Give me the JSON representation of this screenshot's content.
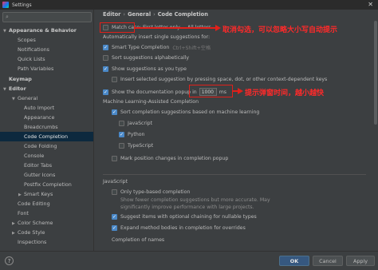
{
  "window": {
    "title": "Settings",
    "close": "✕"
  },
  "sidebar": {
    "search_icon": "search-icon",
    "items": [
      {
        "label": "Appearance & Behavior",
        "bold": true,
        "arrow": "▼"
      },
      {
        "label": "Scopes"
      },
      {
        "label": "Notifications"
      },
      {
        "label": "Quick Lists"
      },
      {
        "label": "Path Variables"
      },
      {
        "label": "Keymap",
        "bold": true
      },
      {
        "label": "Editor",
        "bold": true,
        "arrow": "▼"
      },
      {
        "label": "General",
        "arrow": "▼"
      },
      {
        "label": "Auto Import"
      },
      {
        "label": "Appearance"
      },
      {
        "label": "Breadcrumbs"
      },
      {
        "label": "Code Completion",
        "selected": true
      },
      {
        "label": "Code Folding"
      },
      {
        "label": "Console"
      },
      {
        "label": "Editor Tabs"
      },
      {
        "label": "Gutter Icons"
      },
      {
        "label": "Postfix Completion"
      },
      {
        "label": "Smart Keys",
        "arrow": "▶"
      },
      {
        "label": "Code Editing"
      },
      {
        "label": "Font"
      },
      {
        "label": "Color Scheme",
        "arrow": "▶"
      },
      {
        "label": "Code Style",
        "arrow": "▶"
      },
      {
        "label": "Inspections"
      }
    ]
  },
  "breadcrumb": {
    "parts": [
      "Editor",
      "General",
      "Code Completion"
    ],
    "sep": "›"
  },
  "options": {
    "match_case": "Match case:",
    "first_letter_only": "First letter only",
    "all_letters": "All letters",
    "auto_insert_heading": "Automatically insert single suggestions for:",
    "smart_type_completion": "Smart Type Completion",
    "smart_type_shortcut": "Ctrl+Shift+空格",
    "sort_alpha": "Sort suggestions alphabetically",
    "show_as_you_type": "Show suggestions as you type",
    "insert_selected": "Insert selected suggestion by pressing space, dot, or other context-dependent keys",
    "show_doc_popup": "Show the documentation popup in",
    "doc_popup_value": "1000",
    "doc_popup_unit": "ms",
    "ml_heading": "Machine Learning-Assisted Completion",
    "ml_sort": "Sort completion suggestions based on machine learning",
    "ml_javascript": "JavaScript",
    "ml_python": "Python",
    "ml_typescript": "TypeScript",
    "mark_position": "Mark position changes in completion popup",
    "js_heading": "JavaScript",
    "only_type_based": "Only type-based completion",
    "only_type_based_hint1": "Show fewer completion suggestions but more accurate. May",
    "only_type_based_hint2": "significantly improve performance with large projects.",
    "suggest_optional_chaining": "Suggest items with optional chaining for nullable types",
    "expand_method_bodies": "Expand method bodies in completion for overrides",
    "completion_of_names": "Completion of names"
  },
  "annotations": {
    "match_case_note": "取消勾选，可以忽略大小写自动提示",
    "doc_popup_note": "提示弹窗时间，越小越快"
  },
  "footer": {
    "help": "?",
    "ok": "OK",
    "cancel": "Cancel",
    "apply": "Apply"
  },
  "colors": {
    "accent": "#4a88c7",
    "annotation": "#ff2a2a",
    "selected": "#0d293e"
  }
}
